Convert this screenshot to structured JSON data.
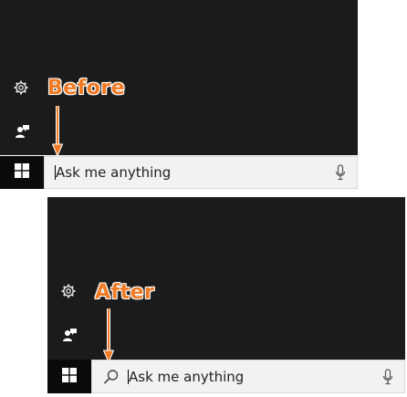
{
  "colors": {
    "accent": "#f07b24",
    "panel": "#1b1b1b",
    "start": "#0a0a0a",
    "search_bg": "#f2f2f2"
  },
  "before": {
    "label": "Before",
    "search": {
      "placeholder": "Ask me anything"
    },
    "icons": [
      "gear-icon",
      "feedback-icon",
      "windows-logo-icon",
      "microphone-icon"
    ]
  },
  "after": {
    "label": "After",
    "search": {
      "placeholder": "Ask me anything"
    },
    "icons": [
      "gear-icon",
      "feedback-icon",
      "windows-logo-icon",
      "search-icon",
      "microphone-icon"
    ]
  }
}
